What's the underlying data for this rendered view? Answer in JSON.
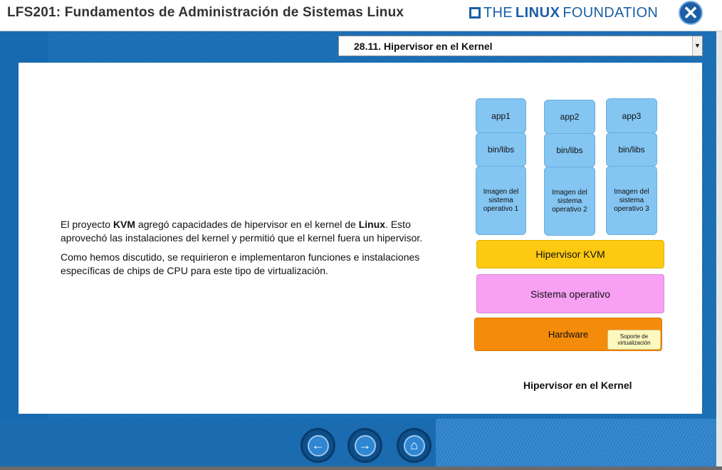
{
  "header": {
    "course_title": "LFS201: Fundamentos de Administración de Sistemas Linux",
    "logo": {
      "the": "THE",
      "linux": "LINUX",
      "foundation": "FOUNDATION"
    },
    "close_icon": "close-icon"
  },
  "section_select": {
    "selected": "28.11. Hipervisor en el Kernel"
  },
  "content": {
    "p1": {
      "pre": "El proyecto ",
      "kvm": "KVM",
      "mid": " agregó capacidades de hipervisor en el kernel de ",
      "linux": "Linux",
      "post": ". Esto aprovechó las instalaciones del kernel y permitió que el kernel fuera un hipervisor."
    },
    "p2": "Como hemos discutido, se requirieron e implementaron funciones e instalaciones específicas de chips de CPU para este tipo de virtualización."
  },
  "diagram": {
    "columns": [
      {
        "app": "app1",
        "libs": "bin/libs",
        "os_image": "Imagen del sistema operativo 1"
      },
      {
        "app": "app2",
        "libs": "bin/libs",
        "os_image": "Imagen del sistema operativo 2"
      },
      {
        "app": "app3",
        "libs": "bin/libs",
        "os_image": "Imagen del sistema operativo 3"
      }
    ],
    "kvm": "Hipervisor KVM",
    "os": "Sistema operativo",
    "hardware": "Hardware",
    "virt_support": "Soporte de virtualización",
    "caption": "Hipervisor en el Kernel",
    "colors": {
      "app_boxes": "#84c5f2",
      "kvm": "#fdc911",
      "os": "#f8a0f4",
      "hardware": "#f58b0a",
      "note": "#fdf8be"
    }
  },
  "nav": {
    "back_icon": "arrow-left-icon",
    "next_icon": "arrow-right-icon",
    "home_icon": "home-icon"
  }
}
